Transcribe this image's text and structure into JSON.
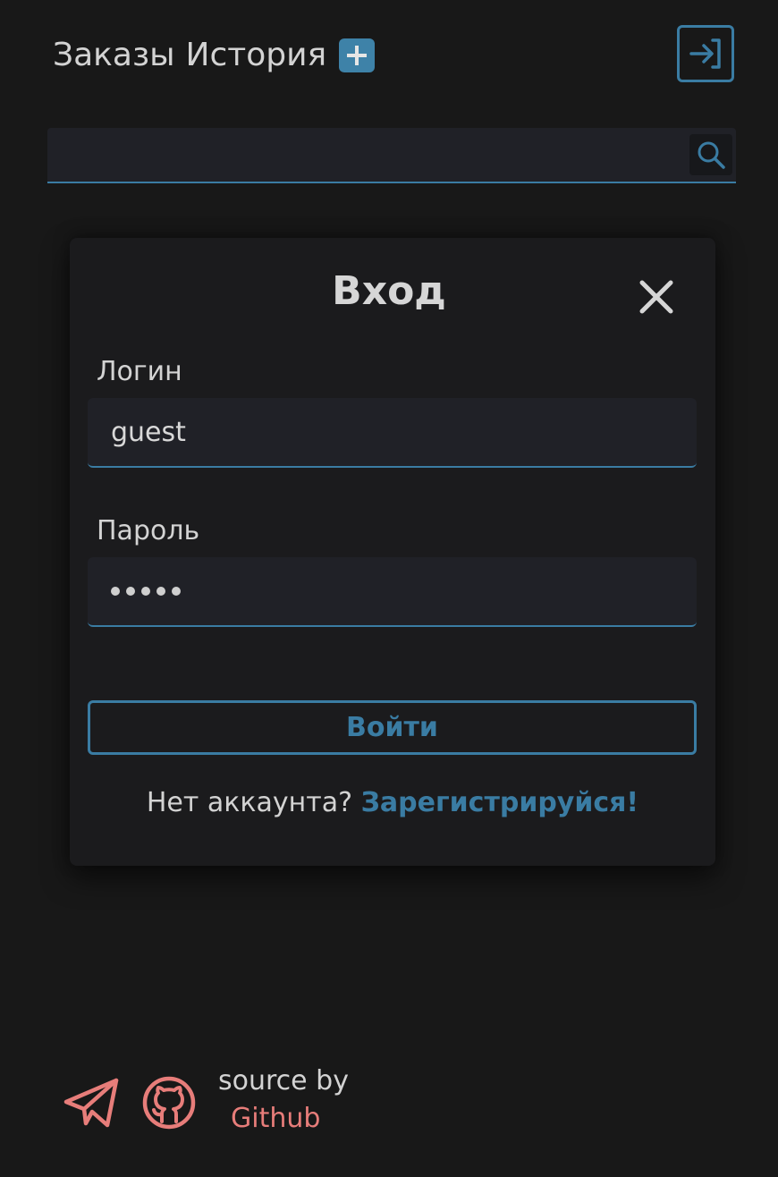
{
  "header": {
    "orders_label": "Заказы",
    "history_label": "История",
    "add_icon": "plus-icon",
    "login_icon": "login-icon",
    "accent_color": "#3a7ca3"
  },
  "search": {
    "value": "",
    "placeholder": "",
    "icon": "search-icon"
  },
  "modal": {
    "title": "Вход",
    "close_icon": "close-icon",
    "login_label": "Логин",
    "login_value": "guest",
    "password_label": "Пароль",
    "password_mask": "•••••",
    "submit_label": "Войти",
    "register_prompt": "Нет аккаунта?",
    "register_link": "Зарегистрируйся!"
  },
  "footer": {
    "telegram_icon": "telegram-icon",
    "github_icon": "github-icon",
    "source_text": "source by",
    "source_link": "Github",
    "link_color": "#e77d7a"
  }
}
